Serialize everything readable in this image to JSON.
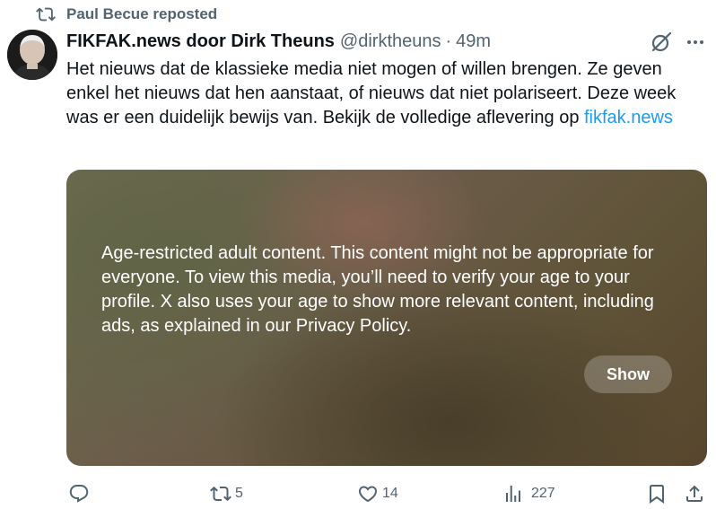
{
  "repost": {
    "text": "Paul Becue reposted"
  },
  "author": {
    "name": "FIKFAK.news door Dirk Theuns",
    "handle": "@dirktheuns",
    "separator": "·",
    "time": "49m"
  },
  "tweet": {
    "text": "Het nieuws dat de klassieke media niet mogen of willen brengen. Ze geven enkel het nieuws dat hen aanstaat, of nieuws dat niet polariseert. Deze week was er een duidelijk bewijs van. Bekijk de volledige aflevering op ",
    "link": "fikfak.news"
  },
  "media": {
    "warning": "Age-restricted adult content. This content might not be appropriate for everyone. To view this media, you’ll need to verify your age to your profile. X also uses your age to show more relevant content, including ads, as explained in our Privacy Policy.",
    "show_label": "Show"
  },
  "actions": {
    "reply_count": "",
    "repost_count": "5",
    "like_count": "14",
    "views_count": "227"
  },
  "icons": [
    "repost-icon",
    "grok-icon",
    "more-icon",
    "reply-icon",
    "retweet-icon",
    "like-icon",
    "views-icon",
    "bookmark-icon",
    "share-icon"
  ],
  "colors": {
    "text": "#0f1419",
    "muted": "#536471",
    "link": "#1d9bf0"
  }
}
